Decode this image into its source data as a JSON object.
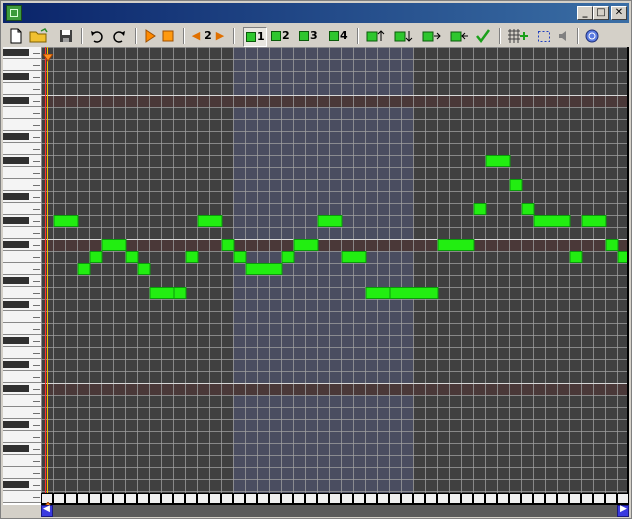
{
  "window": {
    "title": "",
    "buttons": {
      "minimize": "_",
      "maximize": "□",
      "close": "✕"
    }
  },
  "toolbar": {
    "icons": [
      "new-file-icon",
      "open-folder-icon",
      "save-disk-icon",
      "undo-icon",
      "redo-icon",
      "play-icon",
      "stop-icon"
    ],
    "octave": {
      "prev": "◀",
      "value": "2",
      "next": "▶"
    },
    "channels": [
      {
        "label": "1",
        "active": true
      },
      {
        "label": "2",
        "active": false
      },
      {
        "label": "3",
        "active": false
      },
      {
        "label": "4",
        "active": false
      }
    ],
    "note_tools": [
      "note-up-icon",
      "note-down-icon",
      "note-right-icon",
      "note-left-icon",
      "check-icon"
    ],
    "grid_tools": [
      "grid-add-icon",
      "select-rect-icon",
      "speaker-icon",
      "help-icon"
    ]
  },
  "colors": {
    "note": "#22ee11",
    "grid_bg": "#404040",
    "grid_band": "#4a4d60",
    "grid_line": "#a0a0a0",
    "marker_row": "#4a3838",
    "playhead": "#ff3030",
    "cursor_line": "#f0c000",
    "scroll_button": "#3a3ae0"
  },
  "piano_roll": {
    "columns": 48,
    "rows": 37,
    "highlight_rows": [
      4,
      16,
      28
    ],
    "bright_rows": [
      4,
      16,
      28
    ],
    "shaded_column_range": [
      16,
      31
    ],
    "notes": [
      {
        "col": 1,
        "row": 14,
        "len": 2
      },
      {
        "col": 3,
        "row": 18,
        "len": 1
      },
      {
        "col": 4,
        "row": 17,
        "len": 1
      },
      {
        "col": 5,
        "row": 16,
        "len": 2
      },
      {
        "col": 7,
        "row": 17,
        "len": 1
      },
      {
        "col": 8,
        "row": 18,
        "len": 1
      },
      {
        "col": 9,
        "row": 20,
        "len": 2
      },
      {
        "col": 11,
        "row": 20,
        "len": 1
      },
      {
        "col": 12,
        "row": 17,
        "len": 1
      },
      {
        "col": 13,
        "row": 14,
        "len": 2
      },
      {
        "col": 15,
        "row": 16,
        "len": 1
      },
      {
        "col": 16,
        "row": 17,
        "len": 1
      },
      {
        "col": 17,
        "row": 18,
        "len": 3
      },
      {
        "col": 20,
        "row": 17,
        "len": 1
      },
      {
        "col": 21,
        "row": 16,
        "len": 2
      },
      {
        "col": 23,
        "row": 14,
        "len": 2
      },
      {
        "col": 25,
        "row": 17,
        "len": 2
      },
      {
        "col": 27,
        "row": 20,
        "len": 2
      },
      {
        "col": 29,
        "row": 20,
        "len": 4
      },
      {
        "col": 33,
        "row": 16,
        "len": 3
      },
      {
        "col": 36,
        "row": 13,
        "len": 1
      },
      {
        "col": 37,
        "row": 9,
        "len": 2
      },
      {
        "col": 39,
        "row": 11,
        "len": 1
      },
      {
        "col": 40,
        "row": 13,
        "len": 1
      },
      {
        "col": 41,
        "row": 14,
        "len": 3
      },
      {
        "col": 44,
        "row": 17,
        "len": 1
      },
      {
        "col": 45,
        "row": 14,
        "len": 2
      },
      {
        "col": 47,
        "row": 16,
        "len": 1
      },
      {
        "col": 48,
        "row": 17,
        "len": 1
      }
    ]
  },
  "scrollbar": {
    "left": "◀",
    "right": "▶"
  }
}
